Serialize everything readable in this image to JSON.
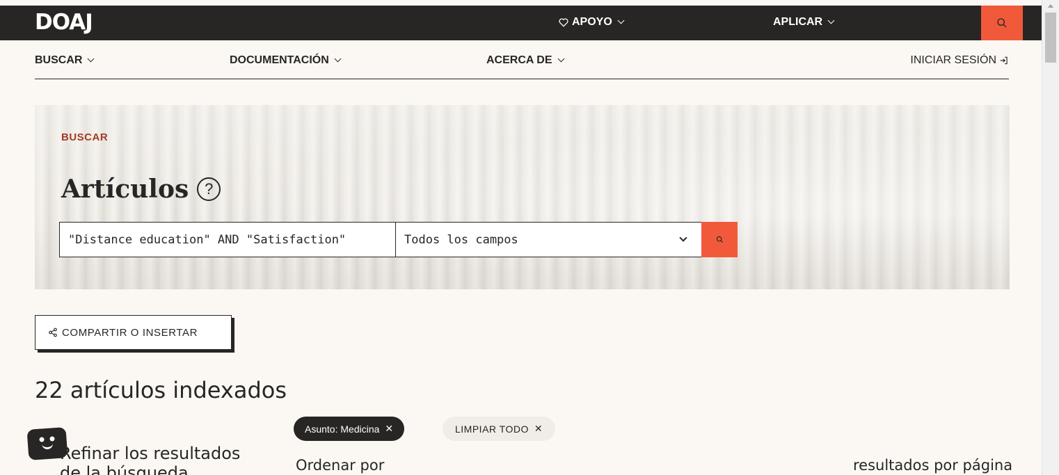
{
  "header": {
    "logo": "DOAJ",
    "support": "APOYO",
    "apply": "APLICAR"
  },
  "nav": {
    "search": "BUSCAR",
    "docs": "DOCUMENTACIÓN",
    "about": "ACERCA DE",
    "login": "INICIAR SESIÓN"
  },
  "hero": {
    "eyebrow": "BUSCAR",
    "title": "Artículos",
    "help": "?",
    "query": "\"Distance education\" AND \"Satisfaction\"",
    "field": "Todos los campos"
  },
  "share": "COMPARTIR O INSERTAR",
  "results": {
    "count": "22 artículos indexados",
    "filter_chip": "Asunto: Medicina",
    "clear_all": "LIMPIAR TODO",
    "refine_line1": "Refinar los resultados",
    "refine_line2": "de la búsqueda",
    "sort_by": "Ordenar por",
    "per_page": "resultados por página"
  },
  "colors": {
    "dark": "#282624",
    "accent": "#f05a3a",
    "eyebrow": "#a33b24",
    "background": "#fbf8f4"
  }
}
